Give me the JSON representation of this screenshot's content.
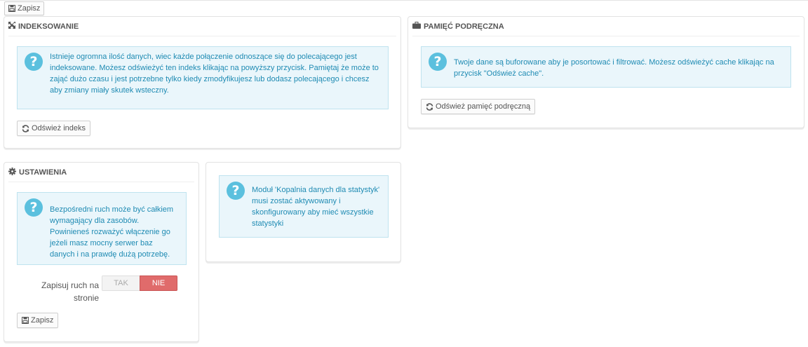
{
  "top_save_label": "Zapisz",
  "indexing": {
    "title": "INDEKSOWANIE",
    "info": "Istnieje ogromna ilość danych, wiec każde połączenie odnoszące się do polecającego jest indeksowane. Możesz odświeżyć ten indeks klikając na powyższy przycisk. Pamiętaj że może to zająć dużo czasu i jest potrzebne tylko kiedy zmodyfikujesz lub dodasz polecającego i chcesz aby zmiany miały skutek wsteczny.",
    "button": "Odśwież indeks"
  },
  "cache": {
    "title": "PAMIĘĆ PODRĘCZNA",
    "info": "Twoje dane są buforowane aby je posortować i filtrować. Możesz odświeżyć cache klikając na przycisk \"Odśwież cache\".",
    "button": "Odśwież pamięć podręczną"
  },
  "settings": {
    "title": "USTAWIENIA",
    "info": "Bezpośredni ruch może być całkiem wymagający dla zasobów. Powinieneś rozważyć włączenie go jeżeli masz mocny serwer baz danych i na prawdę dużą potrzebę.",
    "field_label": "Zapisuj ruch na stronie",
    "toggle_yes": "TAK",
    "toggle_no": "NIE",
    "toggle_selected": "NIE",
    "save_button": "Zapisz"
  },
  "module_info": "Moduł 'Kopalnia danych dla statystyk' musi zostać aktywowany i skonfigurowany aby mieć wszystkie statystyki",
  "colors": {
    "info_bg": "#eaf6fb",
    "info_text": "#1f8bb3",
    "info_icon": "#5bc0de",
    "toggle_active": "#e06b6b"
  },
  "icons": {
    "save": "floppy-disk-icon",
    "indexing": "expand-arrows-icon",
    "cache": "briefcase-icon",
    "settings": "gear-icon",
    "refresh": "refresh-icon",
    "question": "question-circle-icon"
  }
}
